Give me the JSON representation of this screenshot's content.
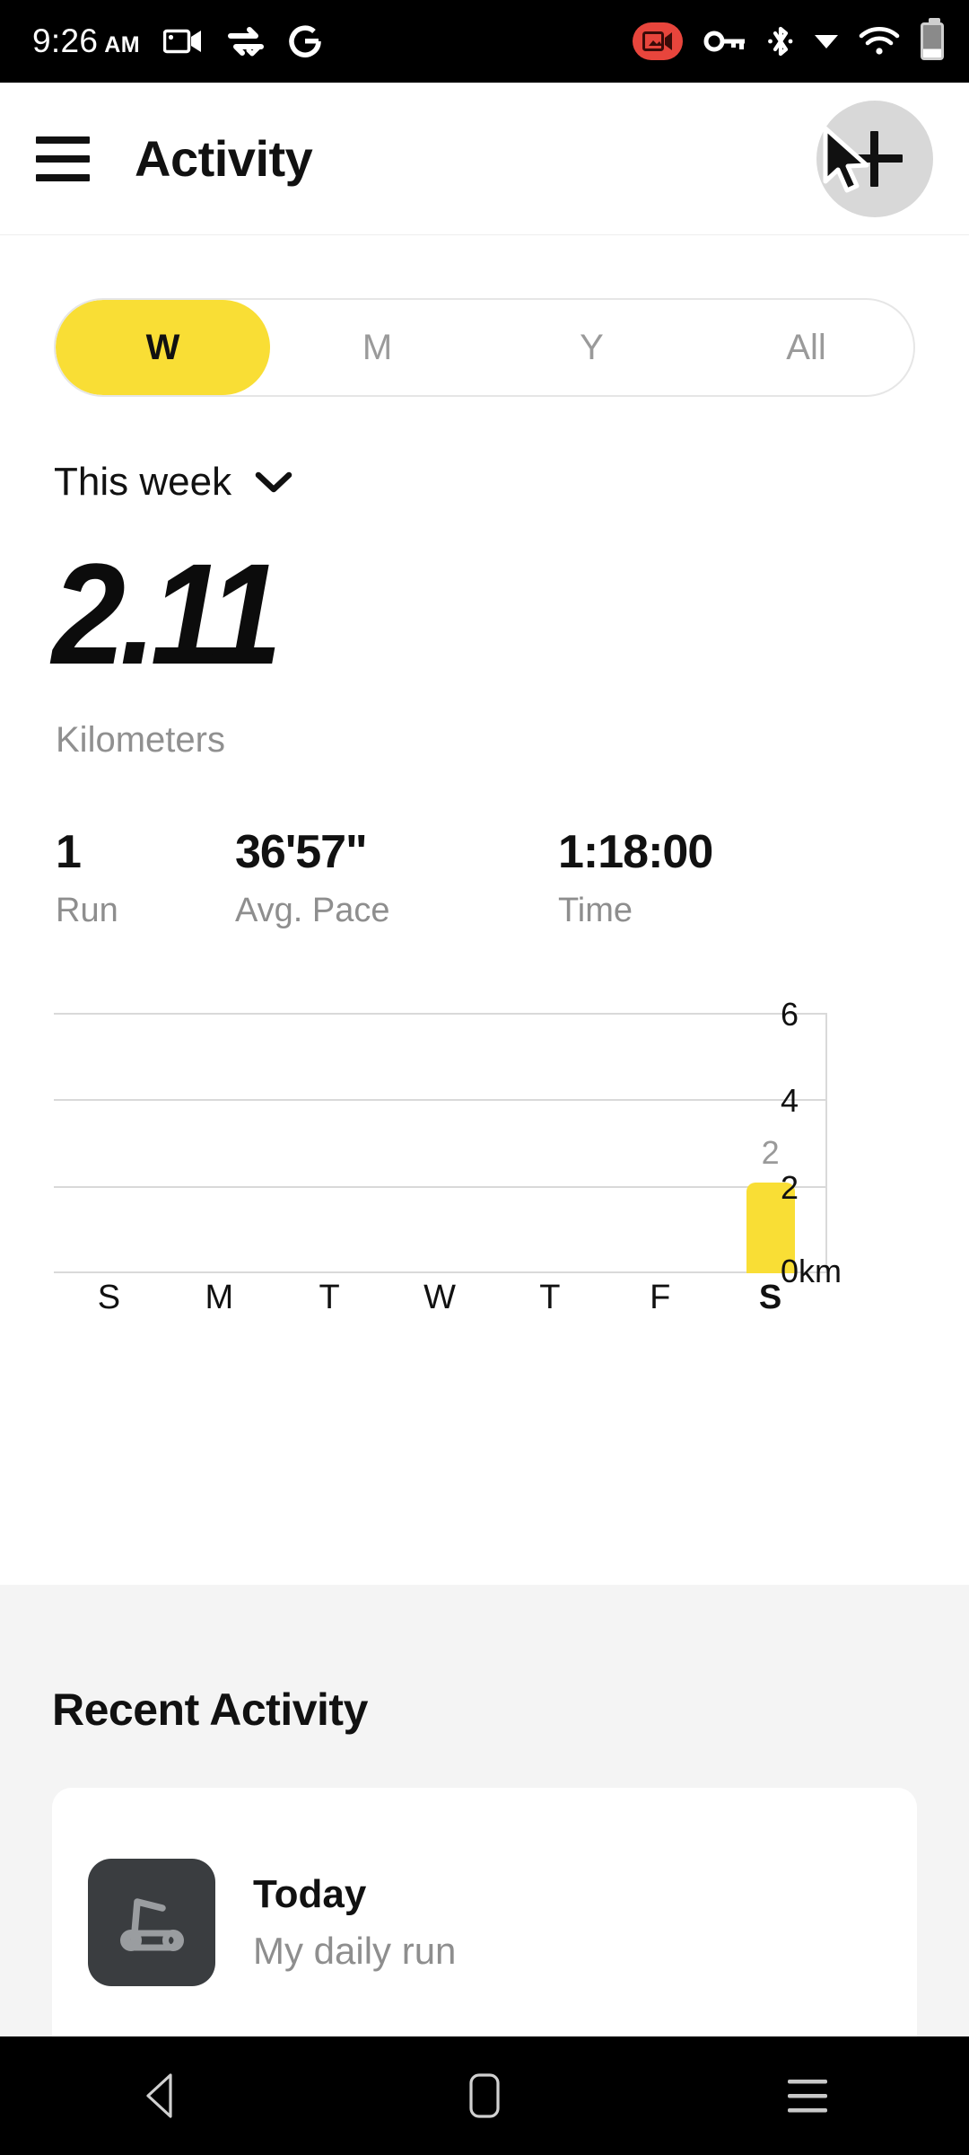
{
  "status_bar": {
    "time": "9:26",
    "ampm": "AM",
    "left_icons": [
      "screen-cast-icon",
      "data-saver-icon",
      "google-g-icon"
    ],
    "right_icons": [
      "screen-recording-icon",
      "vpn-key-icon",
      "bluetooth-icon",
      "dropdown-triangle-icon",
      "wifi-icon",
      "battery-icon"
    ]
  },
  "app_bar": {
    "menu_icon": "hamburger-menu-icon",
    "title": "Activity",
    "add_icon": "plus-icon",
    "cursor": "mouse-cursor"
  },
  "segmented_control": {
    "active_index": 0,
    "options": [
      {
        "label": "W"
      },
      {
        "label": "M"
      },
      {
        "label": "Y"
      },
      {
        "label": "All"
      }
    ]
  },
  "period_selector": {
    "label": "This week",
    "icon": "chevron-down-icon"
  },
  "summary": {
    "value": "2.11",
    "unit": "Kilometers"
  },
  "stats": [
    {
      "value": "1",
      "label": "Run"
    },
    {
      "value": "36'57\"",
      "label": "Avg. Pace"
    },
    {
      "value": "1:18:00",
      "label": "Time"
    }
  ],
  "chart_data": {
    "type": "bar",
    "title": "",
    "xlabel": "",
    "ylabel": "km",
    "categories": [
      "S",
      "M",
      "T",
      "W",
      "T",
      "F",
      "S"
    ],
    "values": [
      0,
      0,
      0,
      0,
      0,
      0,
      2.11
    ],
    "bar_labels": [
      "",
      "",
      "",
      "",
      "",
      "",
      "2"
    ],
    "highlight_index": 6,
    "ylim": [
      0,
      6
    ],
    "yticks": [
      0,
      2,
      4,
      6
    ],
    "ytick_labels": [
      "0km",
      "2",
      "4",
      "6"
    ],
    "grid": true,
    "axis_position": "right",
    "bar_color": "#F9DE35",
    "legend": "none"
  },
  "recent_activity": {
    "title": "Recent Activity",
    "items": [
      {
        "icon": "treadmill-icon",
        "title": "Today",
        "subtitle": "My daily run"
      }
    ]
  },
  "nav_bar": {
    "back_icon": "back-triangle-icon",
    "home_icon": "home-square-icon",
    "recents_icon": "recents-menu-icon"
  },
  "colors": {
    "accent": "#F9DE35",
    "surface": "#FFFFFF",
    "section_bg": "#F4F4F4",
    "thumb_bg": "#3A3D40",
    "text": "#111111",
    "muted": "#8E8E8E",
    "grid": "#D9D9D9",
    "recording": "#E8453C"
  }
}
